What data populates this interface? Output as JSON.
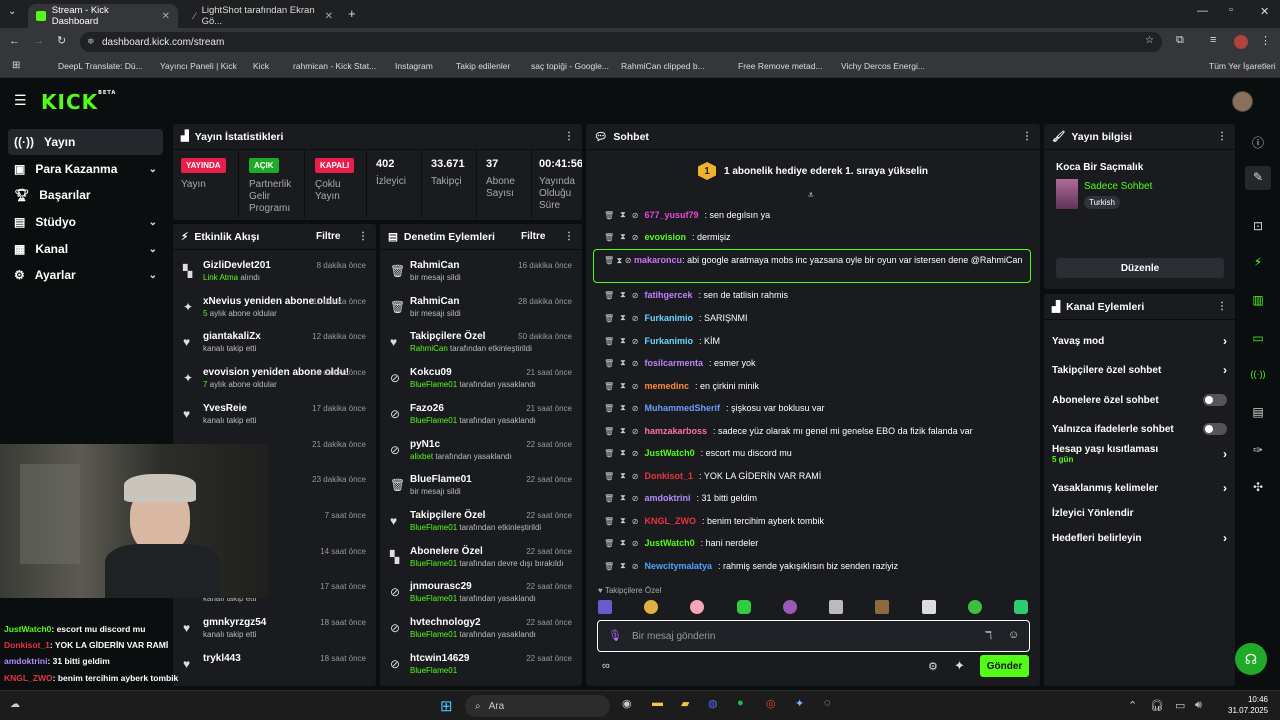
{
  "browser": {
    "tabs": [
      {
        "label": "Stream - Kick Dashboard"
      },
      {
        "label": "LightShot tarafından Ekran Gö..."
      }
    ],
    "url": "dashboard.kick.com/stream",
    "bookmarks": [
      "DeepL Translate: Dü...",
      "Yayıncı Paneli | Kick",
      "Kick",
      "rahmican - Kick Stat...",
      "Instagram",
      "Takip edilenler",
      "saç topiği - Google...",
      "RahmiCan clipped b...",
      "Free Remove metad...",
      "Vichy Dercos Energi...",
      "Tüm Yer İşaretleri"
    ]
  },
  "kick": {
    "logo": "KICK",
    "beta": "BETA"
  },
  "nav": [
    "Yayın",
    "Para Kazanma",
    "Başarılar",
    "Stüdyo",
    "Kanal",
    "Ayarlar"
  ],
  "stats": {
    "title": "Yayın İstatistikleri",
    "items": [
      {
        "pill": "YAYINDA",
        "color": "#e91e4a",
        "label": "Yayın"
      },
      {
        "pill": "AÇIK",
        "color": "#1faa2a",
        "label": "Partnerlik Gelir Programı"
      },
      {
        "pill": "KAPALI",
        "color": "#e91e4a",
        "label": "Çoklu Yayın"
      },
      {
        "num": "402",
        "label": "İzleyici"
      },
      {
        "num": "33.671",
        "label": "Takipçi"
      },
      {
        "num": "37",
        "label": "Abone Sayısı"
      },
      {
        "num": "00:41:56",
        "label": "Yayında Olduğu Süre"
      }
    ]
  },
  "activity": {
    "title": "Etkinlik Akışı",
    "filter": "Filtre",
    "events": [
      {
        "icon": "gift",
        "title": "GizliDevlet201",
        "sub_g": "Link Atma",
        "sub": " alındı",
        "time": "8 dakika önce"
      },
      {
        "icon": "sparkle",
        "title": "xNevius yeniden abone oldu!",
        "sub_g": "5",
        "sub": " aylık abone oldular",
        "time": "11 dakika önce"
      },
      {
        "icon": "heart",
        "title": "giantakaliZx",
        "sub": "kanalı takip etti",
        "time": "12 dakika önce"
      },
      {
        "icon": "sparkle",
        "title": "evovision yeniden abone oldu!",
        "sub_g": "7",
        "sub": " aylık abone oldular",
        "time": "14 dakika önce"
      },
      {
        "icon": "heart",
        "title": "YvesReie",
        "sub": "kanalı takip etti",
        "time": "17 dakika önce"
      },
      {
        "icon": "heart",
        "title": "",
        "sub": "",
        "time": "21 dakika önce"
      },
      {
        "icon": "heart",
        "title": "",
        "sub": "",
        "time": "23 dakika önce"
      },
      {
        "icon": "heart",
        "title": "",
        "sub": "",
        "time": "7 saat önce"
      },
      {
        "icon": "heart",
        "title": "",
        "sub": "",
        "time": "14 saat önce"
      },
      {
        "icon": "heart",
        "title": "WickYTB",
        "sub": "kanalı takip etti",
        "time": "17 saat önce"
      },
      {
        "icon": "heart",
        "title": "gmnkyrzgz54",
        "sub": "kanalı takip etti",
        "time": "18 saat önce"
      },
      {
        "icon": "heart",
        "title": "trykl443",
        "sub": "",
        "time": "18 saat önce"
      }
    ]
  },
  "moderation": {
    "title": "Denetim Eylemleri",
    "filter": "Filtre",
    "events": [
      {
        "icon": "trash",
        "title": "RahmiCan",
        "sub": "bir mesajı sildi",
        "time": "16 dakika önce"
      },
      {
        "icon": "trash",
        "title": "RahmiCan",
        "sub": "bir mesajı sildi",
        "time": "28 dakika önce"
      },
      {
        "icon": "heart",
        "title": "Takipçilere Özel",
        "sub_g": "RahmiCan",
        "sub": " tarafından etkinleştirildi",
        "time": "50 dakika önce"
      },
      {
        "icon": "ban",
        "title": "Kokcu09",
        "sub_g": "BlueFlame01",
        "sub": " tarafından yasaklandı",
        "time": "21 saat önce"
      },
      {
        "icon": "ban",
        "title": "Fazo26",
        "sub_g": "BlueFlame01",
        "sub": " tarafından yasaklandı",
        "time": "21 saat önce"
      },
      {
        "icon": "ban",
        "title": "pyN1c",
        "sub_g": "alixbet",
        "sub": " tarafından yasaklandı",
        "time": "22 saat önce"
      },
      {
        "icon": "trash",
        "title": "BlueFlame01",
        "sub": "bir mesajı sildi",
        "time": "22 saat önce"
      },
      {
        "icon": "heart",
        "title": "Takipçilere Özel",
        "sub_g": "BlueFlame01",
        "sub": " tarafından etkinleştirildi",
        "time": "22 saat önce"
      },
      {
        "icon": "gift",
        "title": "Abonelere Özel",
        "sub_g": "BlueFlame01",
        "sub": " tarafından devre dışı bırakıldı",
        "time": "22 saat önce"
      },
      {
        "icon": "ban",
        "title": "jnmourasc29",
        "sub_g": "BlueFlame01",
        "sub": " tarafından yasaklandı",
        "time": "22 saat önce"
      },
      {
        "icon": "ban",
        "title": "hvtechnology2",
        "sub_g": "BlueFlame01",
        "sub": " tarafından yasaklandı",
        "time": "22 saat önce"
      },
      {
        "icon": "ban",
        "title": "htcwin14629",
        "sub_g": "BlueFlame01",
        "sub": "",
        "time": "22 saat önce"
      }
    ]
  },
  "chat": {
    "title": "Sohbet",
    "gift_banner": "1 abonelik hediye ederek 1. sıraya yükselin",
    "gift_badge": "1",
    "messages": [
      {
        "user": "677_yusuf79",
        "color": "#e84bd8",
        "text": "sen degılsın ya"
      },
      {
        "user": "evovision",
        "color": "#53fc18",
        "text": "dermişiz"
      },
      {
        "user": "makaroncu",
        "color": "#d070ff",
        "text": "abi google aratmaya mobs inc yazsana oyle bir oyun var istersen dene @RahmiCan",
        "highlight": true
      },
      {
        "user": "fatihgercek",
        "color": "#c080ff",
        "text": "sen de tatlisin rahmis"
      },
      {
        "user": "Furkanimio",
        "color": "#6ad6ff",
        "text": "SARIŞNMI"
      },
      {
        "user": "Furkanimio",
        "color": "#6ad6ff",
        "text": "KİM"
      },
      {
        "user": "fosilcarmenta",
        "color": "#c080ff",
        "text": "esmer yok"
      },
      {
        "user": "memedinc",
        "color": "#ff8a3d",
        "text": "en çirkini minik"
      },
      {
        "user": "MuhammedSherif",
        "color": "#6a9dff",
        "text": "şişkosu var boklusu var"
      },
      {
        "user": "hamzakarboss",
        "color": "#ff6fa8",
        "text": "sadece yüz olarak mı genel mi genelse EBO da fizik falanda var"
      },
      {
        "user": "JustWatch0",
        "color": "#53fc18",
        "text": "escort mu discord mu"
      },
      {
        "user": "Donkisot_1",
        "color": "#e8343f",
        "text": "YOK LA GİDERİN VAR RAMİ"
      },
      {
        "user": "amdoktrini",
        "color": "#b58cff",
        "text": "31 bitti geldim"
      },
      {
        "user": "KNGL_ZWO",
        "color": "#e8343f",
        "text": "benim tercihim ayberk tombik"
      },
      {
        "user": "JustWatch0",
        "color": "#53fc18",
        "text": "hani nerdeler"
      },
      {
        "user": "Newcitymalatya",
        "color": "#4ea3ff",
        "text": "rahmiş sende yakışıklısın biz senden raziyiz"
      }
    ],
    "emote_section": "Takipçilere Özel",
    "placeholder": "Bir mesaj gönderin",
    "send": "Gönder"
  },
  "stream_info": {
    "title": "Yayın bilgisi",
    "stream_title": "Koca Bir Saçmalık",
    "category": "Sadece Sohbet",
    "tag": "Turkish",
    "edit": "Düzenle"
  },
  "channel_actions": {
    "title": "Kanal Eylemleri",
    "items": [
      {
        "label": "Yavaş mod",
        "type": "chev"
      },
      {
        "label": "Takipçilere özel sohbet",
        "type": "chev"
      },
      {
        "label": "Abonelere özel sohbet",
        "type": "toggle"
      },
      {
        "label": "Yalnızca ifadelerle sohbet",
        "type": "toggle"
      },
      {
        "label": "Hesap yaşı kısıtlaması",
        "sub": "5 gün",
        "type": "chev"
      },
      {
        "label": "Yasaklanmış kelimeler",
        "type": "chev"
      },
      {
        "label": "İzleyici Yönlendir",
        "type": "none"
      },
      {
        "label": "Hedefleri belirleyin",
        "type": "chev"
      }
    ]
  },
  "overlay_chat": [
    {
      "user": "JustWatch0",
      "color": "#53fc18",
      "text": ": escort mu discord mu"
    },
    {
      "user": "Donkisot_1",
      "color": "#e8343f",
      "text": ": YOK LA GİDERİN VAR RAMİ"
    },
    {
      "user": "amdoktrini",
      "color": "#b58cff",
      "text": ": 31 bitti geldim"
    },
    {
      "user": "KNGL_ZWO",
      "color": "#e8343f",
      "text": ": benim tercihim ayberk tombik"
    },
    {
      "user": "JustWatch0",
      "color": "#53fc18",
      "text": ": hani nerdeler"
    },
    {
      "user": "Newcitymalatya",
      "color": "#4ea3ff",
      "text": ": rahmiş sende yakışıklısın biz senden raziyiz"
    }
  ],
  "taskbar": {
    "search": "Ara",
    "time": "10:46",
    "date": "31.07.2025"
  }
}
